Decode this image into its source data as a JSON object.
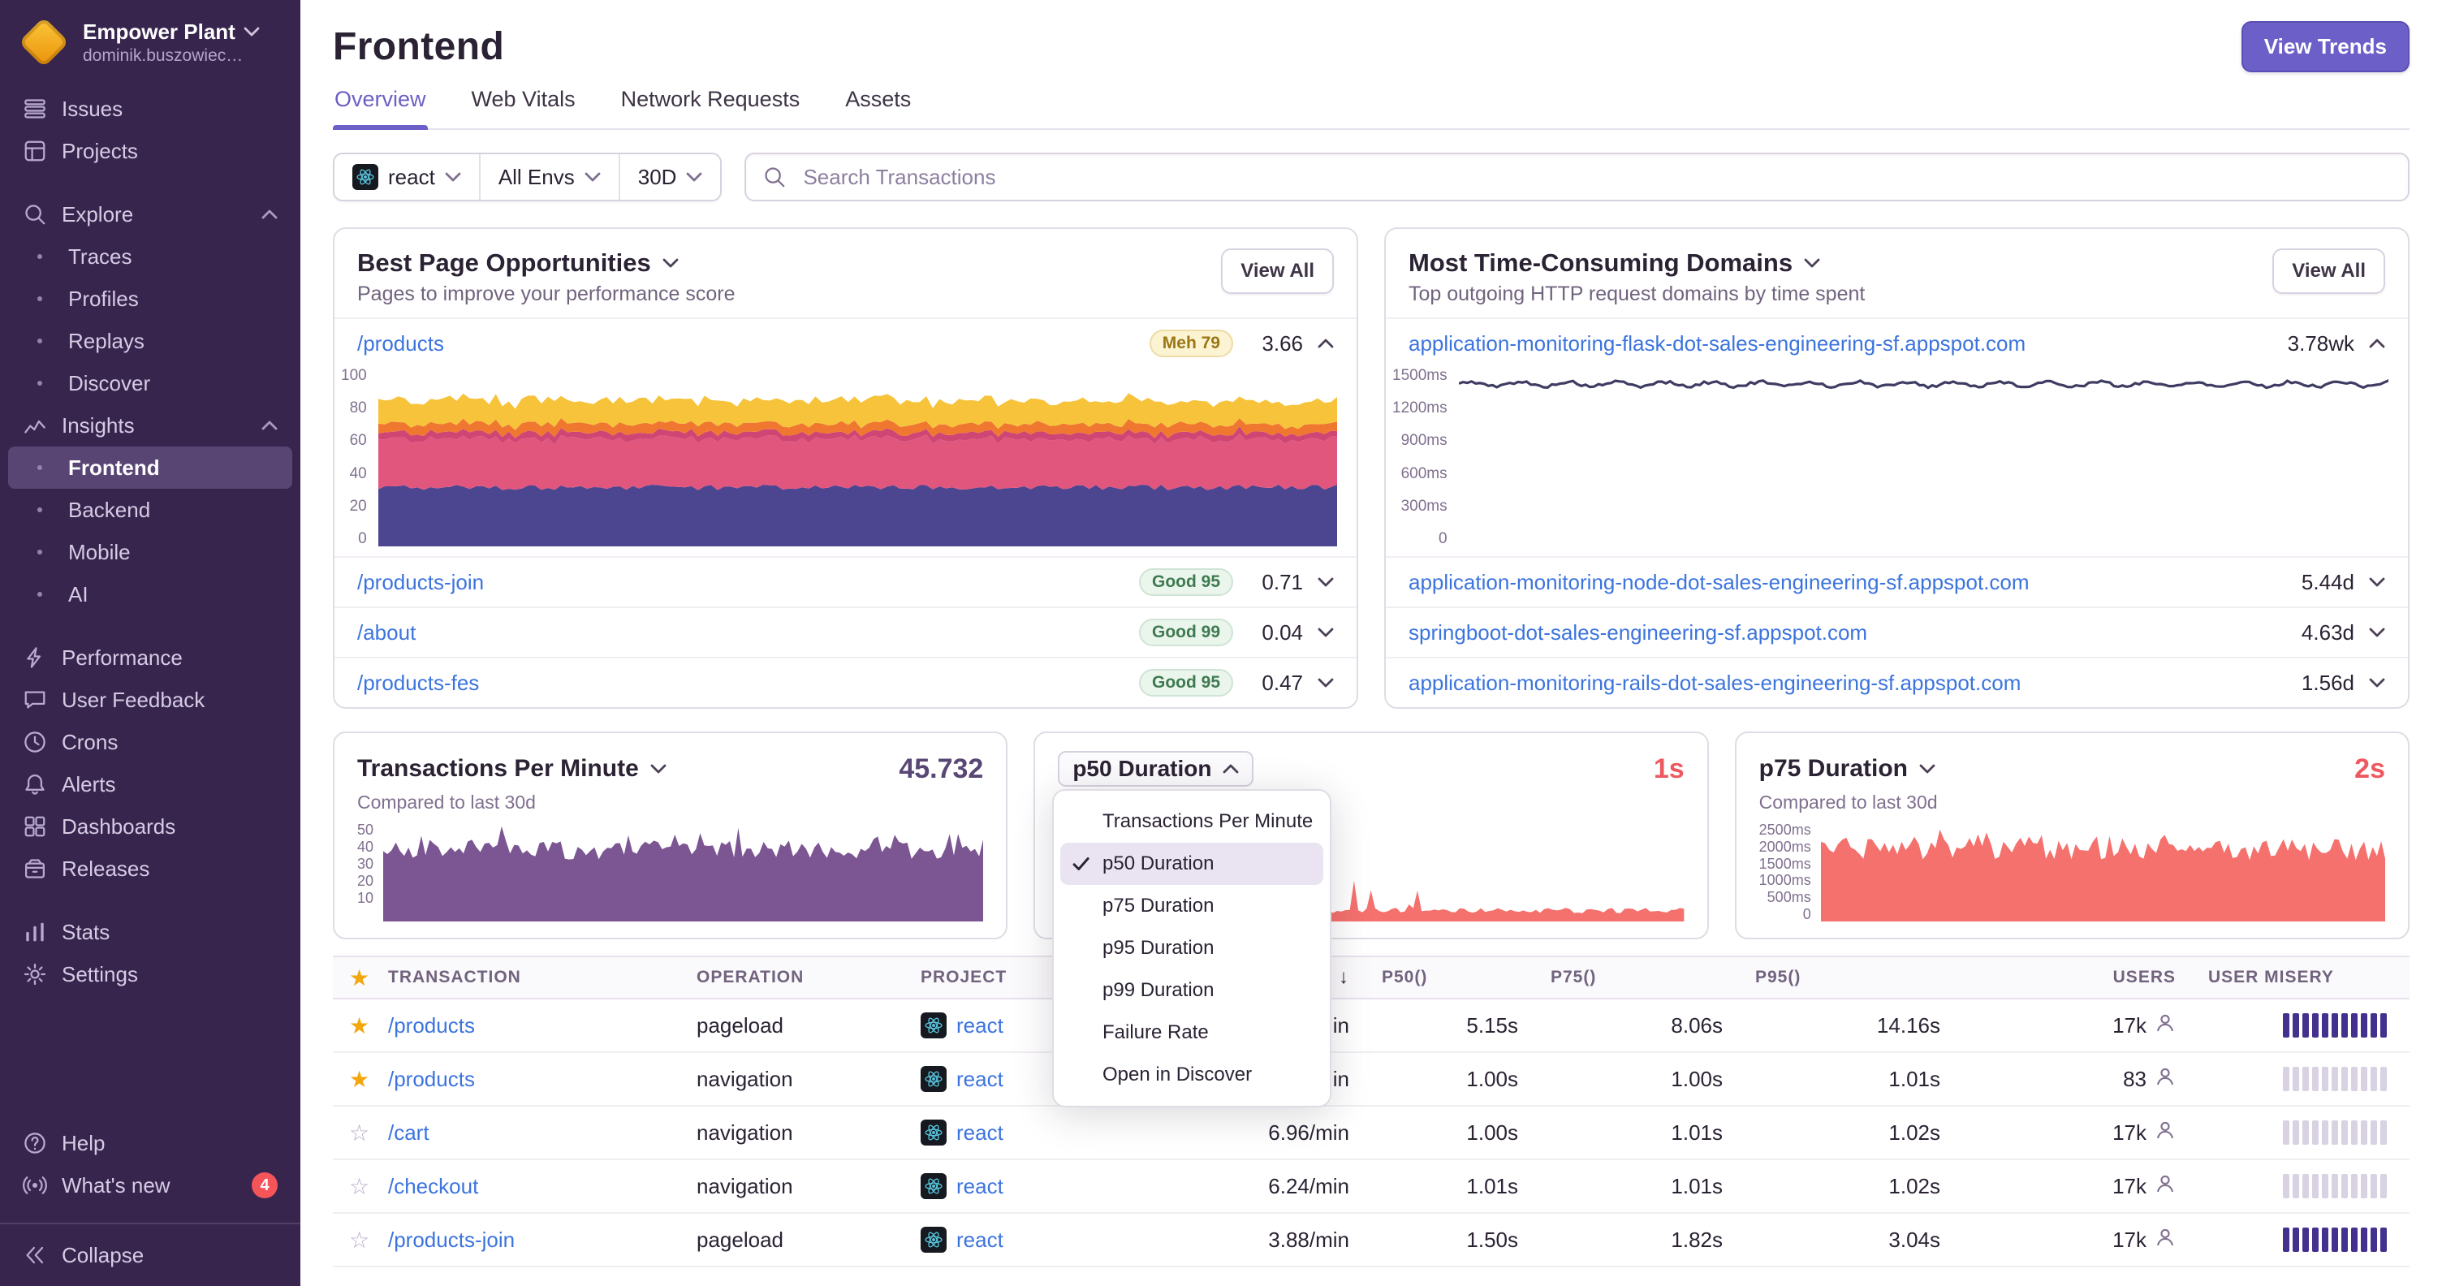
{
  "sidebar": {
    "org": {
      "name": "Empower Plant",
      "subtitle": "dominik.buszowiec…"
    },
    "sections": [
      [
        {
          "id": "issues",
          "label": "Issues",
          "icon": "issues-icon"
        },
        {
          "id": "projects",
          "label": "Projects",
          "icon": "projects-icon"
        }
      ],
      [
        {
          "id": "explore",
          "label": "Explore",
          "icon": "search-icon",
          "chevron": "up"
        },
        {
          "id": "traces",
          "label": "Traces",
          "sub": true
        },
        {
          "id": "profiles",
          "label": "Profiles",
          "sub": true
        },
        {
          "id": "replays",
          "label": "Replays",
          "sub": true
        },
        {
          "id": "discover",
          "label": "Discover",
          "sub": true
        },
        {
          "id": "insights",
          "label": "Insights",
          "icon": "insights-icon",
          "chevron": "up"
        },
        {
          "id": "frontend",
          "label": "Frontend",
          "sub": true,
          "selected": true
        },
        {
          "id": "backend",
          "label": "Backend",
          "sub": true
        },
        {
          "id": "mobile",
          "label": "Mobile",
          "sub": true
        },
        {
          "id": "ai",
          "label": "AI",
          "sub": true
        }
      ],
      [
        {
          "id": "performance",
          "label": "Performance",
          "icon": "performance-icon"
        },
        {
          "id": "user-feedback",
          "label": "User Feedback",
          "icon": "feedback-icon"
        },
        {
          "id": "crons",
          "label": "Crons",
          "icon": "crons-icon"
        },
        {
          "id": "alerts",
          "label": "Alerts",
          "icon": "alerts-icon"
        },
        {
          "id": "dashboards",
          "label": "Dashboards",
          "icon": "dashboards-icon"
        },
        {
          "id": "releases",
          "label": "Releases",
          "icon": "releases-icon"
        }
      ],
      [
        {
          "id": "stats",
          "label": "Stats",
          "icon": "stats-icon"
        },
        {
          "id": "settings",
          "label": "Settings",
          "icon": "settings-icon"
        }
      ]
    ],
    "footer": [
      {
        "id": "help",
        "label": "Help",
        "icon": "help-icon"
      },
      {
        "id": "whats-new",
        "label": "What's new",
        "icon": "whats-new-icon",
        "badge": "4"
      }
    ],
    "collapse": "Collapse"
  },
  "header": {
    "title": "Frontend",
    "view_trends": "View Trends"
  },
  "tabs": [
    {
      "label": "Overview",
      "active": true
    },
    {
      "label": "Web Vitals"
    },
    {
      "label": "Network Requests"
    },
    {
      "label": "Assets"
    }
  ],
  "filters": {
    "project": "react",
    "env": "All Envs",
    "period": "30D",
    "search_placeholder": "Search Transactions"
  },
  "best_pages": {
    "title": "Best Page Opportunities",
    "subtitle": "Pages to improve your performance score",
    "view_all": "View All",
    "ticks": [
      "100",
      "80",
      "60",
      "40",
      "20",
      "0"
    ],
    "rows": [
      {
        "page": "/products",
        "badge": "Meh 79",
        "badge_kind": "meh",
        "value": "3.66",
        "expanded": true
      },
      {
        "page": "/products-join",
        "badge": "Good 95",
        "badge_kind": "good",
        "value": "0.71"
      },
      {
        "page": "/about",
        "badge": "Good 99",
        "badge_kind": "good",
        "value": "0.04"
      },
      {
        "page": "/products-fes",
        "badge": "Good 95",
        "badge_kind": "good",
        "value": "0.47"
      }
    ]
  },
  "domains": {
    "title": "Most Time-Consuming Domains",
    "subtitle": "Top outgoing HTTP request domains by time spent",
    "view_all": "View All",
    "ticks": [
      "1500ms",
      "1200ms",
      "900ms",
      "600ms",
      "300ms",
      "0"
    ],
    "rows": [
      {
        "domain": "application-monitoring-flask-dot-sales-engineering-sf.appspot.com",
        "value": "3.78wk",
        "expanded": true
      },
      {
        "domain": "application-monitoring-node-dot-sales-engineering-sf.appspot.com",
        "value": "5.44d"
      },
      {
        "domain": "springboot-dot-sales-engineering-sf.appspot.com",
        "value": "4.63d"
      },
      {
        "domain": "application-monitoring-rails-dot-sales-engineering-sf.appspot.com",
        "value": "1.56d"
      }
    ]
  },
  "metric_cards": [
    {
      "title": "Transactions Per Minute",
      "value": "45.732",
      "value_color": "purple",
      "subtitle": "Compared to last 30d",
      "ticks": [
        "50",
        "40",
        "30",
        "20",
        "10"
      ],
      "chart": "tpm"
    },
    {
      "title": "p50 Duration",
      "value": "1s",
      "value_color": "red",
      "open": true,
      "chart": "p50"
    },
    {
      "title": "p75 Duration",
      "value": "2s",
      "value_color": "red",
      "subtitle": "Compared to last 30d",
      "ticks": [
        "2500ms",
        "2000ms",
        "1500ms",
        "1000ms",
        "500ms",
        "0"
      ],
      "chart": "p75"
    }
  ],
  "dropdown": [
    {
      "label": "Transactions Per Minute"
    },
    {
      "label": "p50 Duration",
      "checked": true
    },
    {
      "label": "p75 Duration"
    },
    {
      "label": "p95 Duration"
    },
    {
      "label": "p99 Duration"
    },
    {
      "label": "Failure Rate"
    },
    {
      "label": "Open in Discover"
    }
  ],
  "table": {
    "columns": [
      "",
      "TRANSACTION",
      "OPERATION",
      "PROJECT",
      "",
      "P50()",
      "P75()",
      "P95()",
      "USERS",
      "USER MISERY"
    ],
    "sort_icon": "↓",
    "rows": [
      {
        "starred": true,
        "transaction": "/products",
        "operation": "pageload",
        "project": "react",
        "tpm": "in",
        "p50": "5.15s",
        "p75": "8.06s",
        "p95": "14.16s",
        "users": "17k",
        "misery": "dark"
      },
      {
        "starred": true,
        "transaction": "/products",
        "operation": "navigation",
        "project": "react",
        "tpm": "in",
        "p50": "1.00s",
        "p75": "1.00s",
        "p95": "1.01s",
        "users": "83",
        "misery": "light"
      },
      {
        "starred": false,
        "transaction": "/cart",
        "operation": "navigation",
        "project": "react",
        "tpm": "6.96/min",
        "p50": "1.00s",
        "p75": "1.01s",
        "p95": "1.02s",
        "users": "17k",
        "misery": "light"
      },
      {
        "starred": false,
        "transaction": "/checkout",
        "operation": "navigation",
        "project": "react",
        "tpm": "6.24/min",
        "p50": "1.01s",
        "p75": "1.01s",
        "p95": "1.02s",
        "users": "17k",
        "misery": "light"
      },
      {
        "starred": false,
        "transaction": "/products-join",
        "operation": "pageload",
        "project": "react",
        "tpm": "3.88/min",
        "p50": "1.50s",
        "p75": "1.82s",
        "p95": "3.04s",
        "users": "17k",
        "misery": "dark"
      }
    ]
  },
  "colors": {
    "accent": "#6c5fc7",
    "link": "#3c74dd",
    "red_value": "#ee5860",
    "purple_value": "#584674",
    "red_chart": "#f4716d",
    "purple_chart": "#7b5692",
    "line": "#3f3c63",
    "stack": [
      "#4c4590",
      "#e1567d",
      "#cf4674",
      "#f0772f",
      "#f6c33b"
    ],
    "misery_dark": "#44318e",
    "misery_light": "#d8d2e2",
    "badge_red": "#f55459",
    "gold": "#f2a70f"
  }
}
